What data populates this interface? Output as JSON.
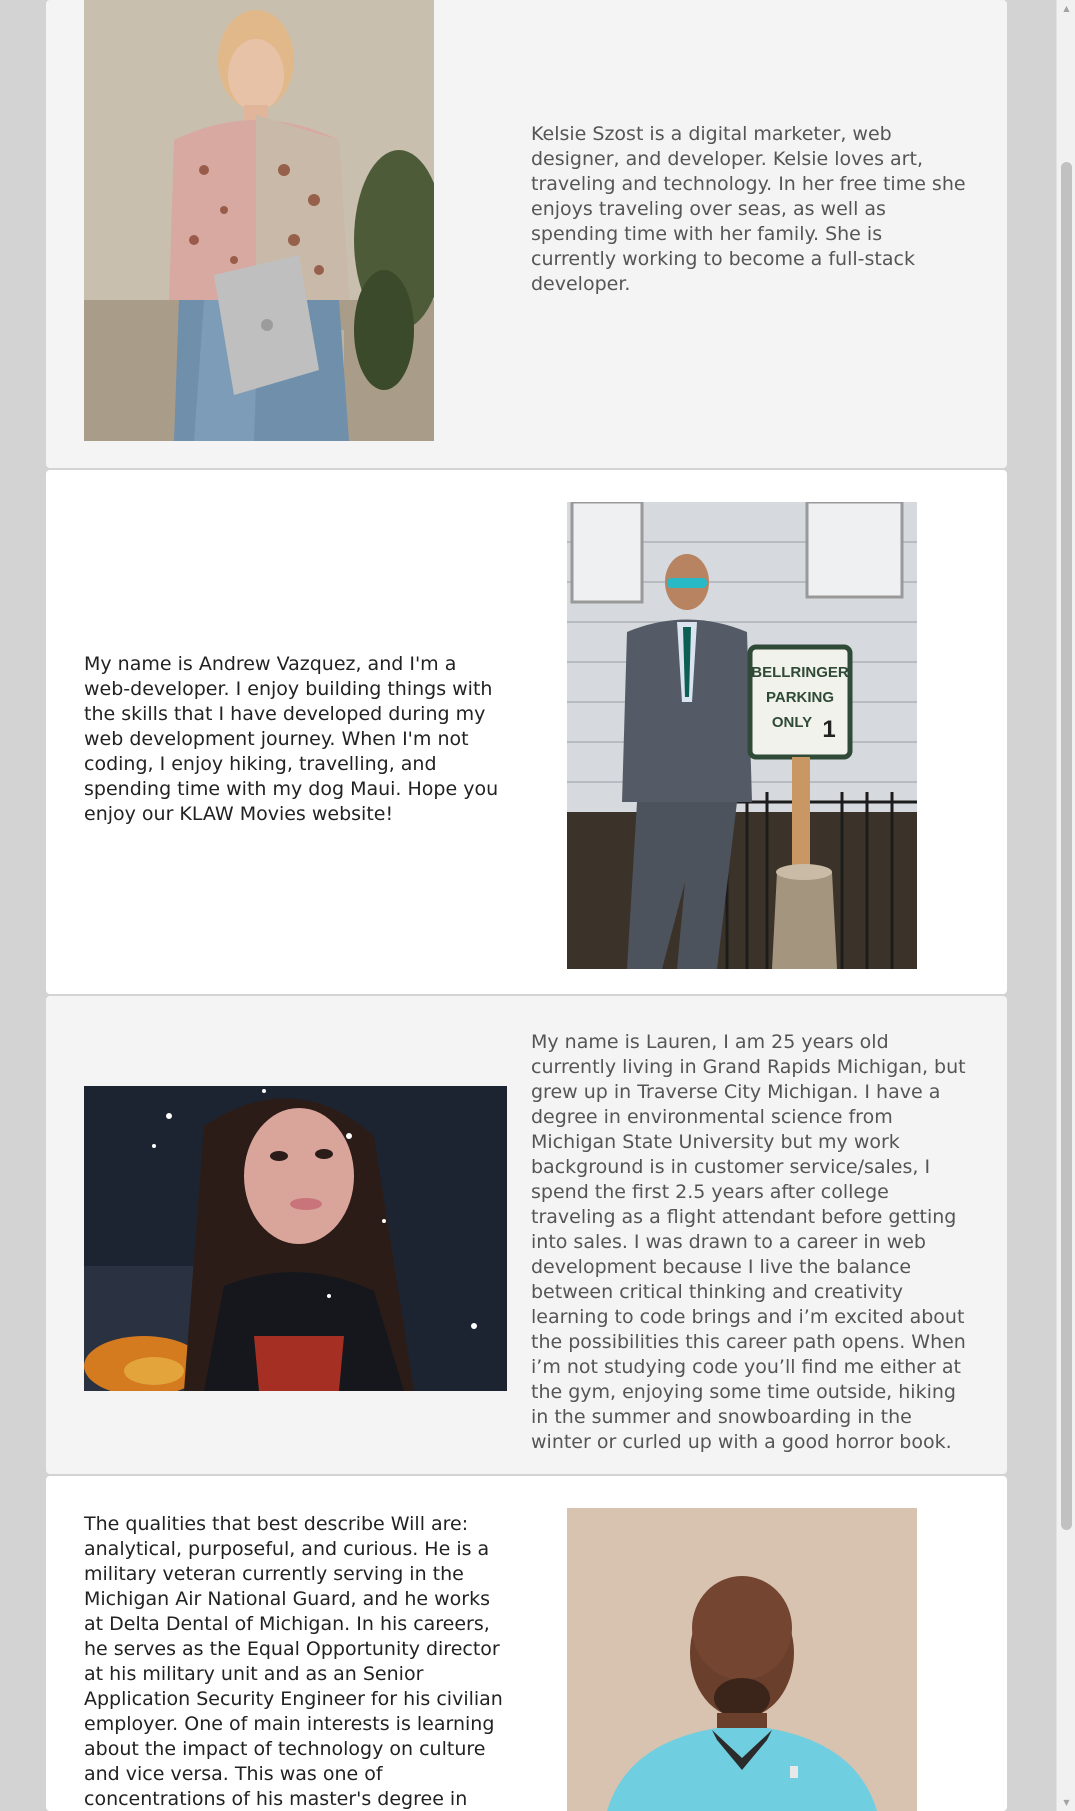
{
  "team": [
    {
      "name": "Kelsie Szost",
      "photo_alt": "Kelsie Szost",
      "bio": "Kelsie Szost is a digital marketer, web designer, and developer. Kelsie loves art, traveling and technology. In her free time she enjoys traveling over seas, as well as spending time with her family. She is currently working to become a full-stack developer."
    },
    {
      "name": "Andrew Vazquez",
      "photo_alt": "Andrew Vazquez",
      "bio": "My name is Andrew Vazquez, and I'm a web-developer. I enjoy building things with the skills that I have developed during my web development journey. When I'm not coding, I enjoy hiking, travelling, and spending time with my dog Maui. Hope you enjoy our KLAW Movies website!",
      "photo_sign": [
        "BELLRINGER",
        "PARKING",
        "ONLY",
        "1"
      ]
    },
    {
      "name": "Lauren",
      "photo_alt": "Lauren",
      "bio": "My name is Lauren, I am 25 years old currently living in Grand Rapids Michigan, but grew up in Traverse City Michigan. I have a degree in environmental science from Michigan State University but my work background is in customer service/sales, I spend the first 2.5 years after college traveling as a flight attendant before getting into sales. I was drawn to a career in web development because I live the balance between critical thinking and creativity learning to code brings and i’m excited about the possibilities this career path opens. When i’m not studying code you’ll find me either at the gym, enjoying some time outside, hiking in the summer and snowboarding in the winter or curled up with a good horror book."
    },
    {
      "name": "Will",
      "photo_alt": "Will",
      "bio": "The qualities that best describe Will are: analytical, purposeful, and curious. He is a military veteran currently serving in the Michigan Air National Guard, and he works at Delta Dental of Michigan. In his careers, he serves as the Equal Opportunity director at his military unit and as an Senior Application Security Engineer for his civilian employer. One of main interests is learning about the impact of technology on culture and vice versa. This was one of concentrations of his master's degree in network security. In his spare time, he"
    }
  ],
  "scrollbar": {
    "up_icon": "triangle-up-icon",
    "down_icon": "triangle-down-icon"
  }
}
